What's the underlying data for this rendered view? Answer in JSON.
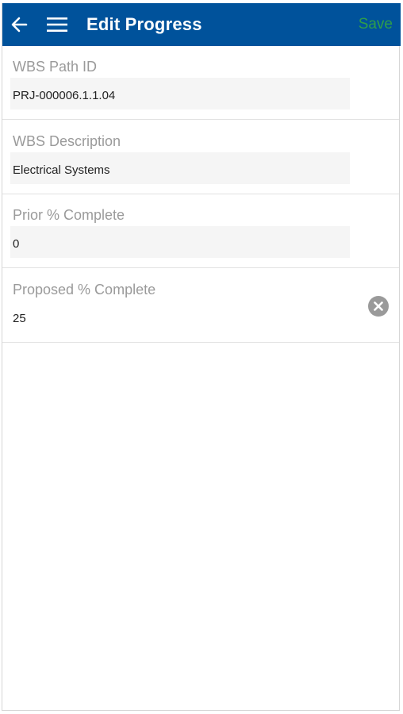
{
  "appbar": {
    "title": "Edit Progress",
    "save_label": "Save",
    "back_icon": "arrow-left-icon",
    "menu_icon": "hamburger-menu-icon",
    "bg_color": "#00529b",
    "save_color": "#2e9e4a"
  },
  "fields": {
    "wbs_path_id": {
      "label": "WBS Path ID",
      "value": "PRJ-000006.1.1.04"
    },
    "wbs_description": {
      "label": "WBS Description",
      "value": "Electrical Systems"
    },
    "prior_complete": {
      "label": "Prior % Complete",
      "value": "0"
    },
    "proposed_complete": {
      "label": "Proposed % Complete",
      "value": "25",
      "clear_icon": "clear-circle-icon"
    }
  }
}
